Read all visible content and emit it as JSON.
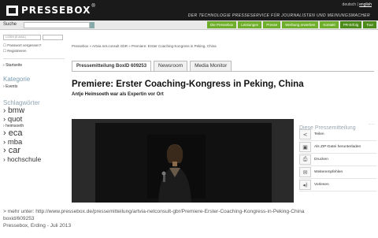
{
  "header": {
    "logo_text": "PRESSEBOX",
    "logo_mark": "®",
    "lang_prefix": "deutsch | ",
    "lang_active": "english",
    "tagline": "DER TECHNOLOGIE PRESSESERVICE FÜR JOURNALISTEN UND MEINUNGSMACHER"
  },
  "search": {
    "label": "Suche"
  },
  "nav": {
    "items": [
      "Die Pressebox",
      "Leistungen",
      "Presse",
      "Werbung erwerben",
      "Kontakt",
      "PR-Erfolg",
      "Tour"
    ]
  },
  "sidebar": {
    "login_placeholder": "LOGIN (E-MAIL)",
    "forgot_password": "Passwort vergessen?",
    "register": "Registrieren",
    "startseite": "Startseite",
    "kategorie_heading": "Kategorie",
    "events": "Events",
    "tags_heading": "Schlagwörter",
    "tags": [
      "bmw",
      "quot",
      "heimsoeth",
      "eca",
      "mba",
      "car",
      "hochschule"
    ]
  },
  "breadcrumb": "Pressebox » Artvia net.consult GbR » Premiere: Erster Coaching-Kongress in Peking, China",
  "tabs": {
    "active": "Pressemitteilung BoxID 609253",
    "newsroom": "Newsroom",
    "media_monitor": "Media Monitor"
  },
  "article": {
    "headline": "Premiere: Erster Coaching-Kongress in Peking, China",
    "subheadline": "Antje Heimsoeth war als Expertin vor Ort"
  },
  "right_panel": {
    "title": "Diese Pressemitteilung",
    "dots": "......",
    "items": [
      {
        "label": "Teilen",
        "icon": "share-icon"
      },
      {
        "label": "Als ZIP-Datei herunterladen",
        "icon": "download-zip-icon"
      },
      {
        "label": "Drucken",
        "icon": "print-icon"
      },
      {
        "label": "Weiterempfehlen",
        "icon": "mail-icon"
      },
      {
        "label": "Vorlesen",
        "icon": "speaker-icon"
      }
    ]
  },
  "caption": {
    "line1": "> mehr unter: http://www.pressebox.de/pressemitteilung/artvia-netconsult-gbr/Premiere-Erster-Coaching-Kongress-in-Peking-China",
    "line2": "boxid/609253",
    "line3": "Pressebox, Erding - Juli 2013"
  }
}
